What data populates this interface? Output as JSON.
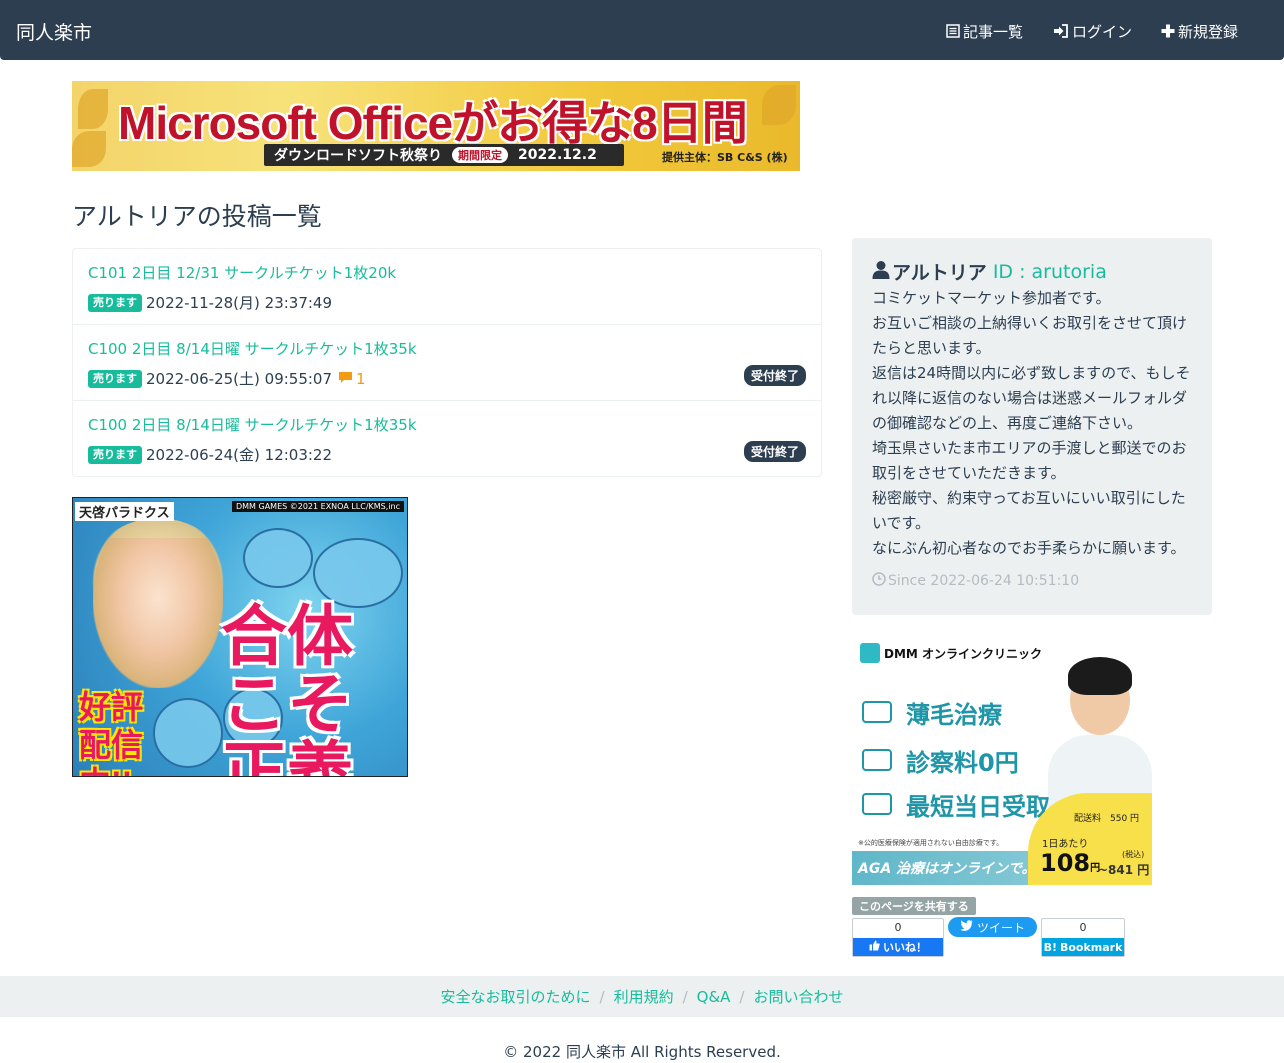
{
  "navbar": {
    "brand": "同人楽市",
    "items": [
      {
        "label": "記事一覧",
        "icon": "list-icon"
      },
      {
        "label": "ログイン",
        "icon": "sign-in-icon"
      },
      {
        "label": "新規登録",
        "icon": "plus-icon"
      }
    ]
  },
  "top_banner": {
    "headline": "Microsoft Officeがお得な8日間",
    "strip_text": "ダウンロードソフト秋祭り",
    "strip_period_label": "期間限定",
    "strip_date": "2022.12.2",
    "sponsor": "提供主体：SB C&S (株)"
  },
  "page_title": "アルトリアの投稿一覧",
  "posts": [
    {
      "title": "C101 2日目 12/31 サークルチケット1枚20k",
      "badge": "売ります",
      "datetime": "2022-11-28(月) 23:37:49",
      "comments": "",
      "status": ""
    },
    {
      "title": "C100 2日目 8/14日曜 サークルチケット1枚35k",
      "badge": "売ります",
      "datetime": "2022-06-25(土) 09:55:07",
      "comments": "1",
      "status": "受付終了"
    },
    {
      "title": "C100 2日目 8/14日曜 サークルチケット1枚35k",
      "badge": "売ります",
      "datetime": "2022-06-24(金) 12:03:22",
      "comments": "",
      "status": "受付終了"
    }
  ],
  "game_ad": {
    "title_tag": "天啓パラドクス",
    "copyright": "DMM GAMES ©2021 EXNOA LLC/KMS,inc",
    "main_text": "合体こそ正義",
    "side_text": "好評配信中!!"
  },
  "profile": {
    "name": "アルトリア",
    "id_label": "ID : arutoria",
    "bio": [
      "コミケットマーケット参加者です。",
      "お互いご相談の上納得いくお取引をさせて頂けたらと思います。",
      "返信は24時間以内に必ず致しますので、もしそれ以降に返信のない場合は迷惑メールフォルダの御確認などの上、再度ご連絡下さい。",
      "埼玉県さいたま市エリアの手渡しと郵送でのお取引をさせていただきます。",
      "秘密厳守、約束守ってお互いにいい取引にしたいです。",
      "なにぶん初心者なのでお手柔らかに願います。"
    ],
    "since": "Since 2022-06-24 10:51:10"
  },
  "clinic_ad": {
    "brand": "DMM オンラインクリニック",
    "rows": [
      "薄毛治療",
      "診察料0円",
      "最短当日受取"
    ],
    "note": "※公的医療保険が適用されない自由診療です。",
    "shipping": "配送料　550 円",
    "per_day": "1日あたり",
    "price": "108",
    "price_unit": "円",
    "tax_label": "(税込)",
    "price_alt": "~841 円",
    "bottom_text": "AGA 治療はオンラインで。"
  },
  "share": {
    "label": "このページを共有する",
    "fb_count": "0",
    "fb_label": "いいね！",
    "tweet_label": "ツイート",
    "hatena_count": "0",
    "hatena_label": "Bookmark"
  },
  "footer": {
    "links": [
      "安全なお取引のために",
      "利用規約",
      "Q&A",
      "お問い合わせ"
    ],
    "copyright": "© 2022 同人楽市 All Rights Reserved."
  },
  "colors": {
    "navbar_bg": "#2c3e50",
    "link": "#18bc9c",
    "badge_sell": "#18bc9c",
    "badge_closed": "#2c3e50",
    "comment": "#f39c12",
    "panel_bg": "#ecf0f1",
    "muted": "#b4bcc2"
  }
}
